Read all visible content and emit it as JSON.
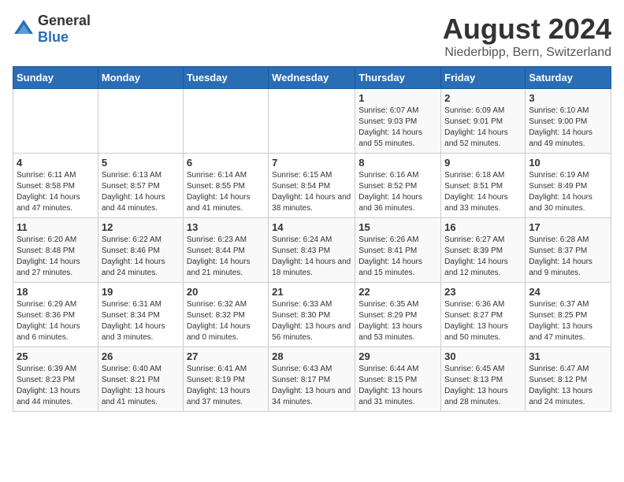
{
  "logo": {
    "general": "General",
    "blue": "Blue"
  },
  "title": "August 2024",
  "subtitle": "Niederbipp, Bern, Switzerland",
  "days_of_week": [
    "Sunday",
    "Monday",
    "Tuesday",
    "Wednesday",
    "Thursday",
    "Friday",
    "Saturday"
  ],
  "weeks": [
    [
      {
        "day": "",
        "details": ""
      },
      {
        "day": "",
        "details": ""
      },
      {
        "day": "",
        "details": ""
      },
      {
        "day": "",
        "details": ""
      },
      {
        "day": "1",
        "details": "Sunrise: 6:07 AM\nSunset: 9:03 PM\nDaylight: 14 hours and 55 minutes."
      },
      {
        "day": "2",
        "details": "Sunrise: 6:09 AM\nSunset: 9:01 PM\nDaylight: 14 hours and 52 minutes."
      },
      {
        "day": "3",
        "details": "Sunrise: 6:10 AM\nSunset: 9:00 PM\nDaylight: 14 hours and 49 minutes."
      }
    ],
    [
      {
        "day": "4",
        "details": "Sunrise: 6:11 AM\nSunset: 8:58 PM\nDaylight: 14 hours and 47 minutes."
      },
      {
        "day": "5",
        "details": "Sunrise: 6:13 AM\nSunset: 8:57 PM\nDaylight: 14 hours and 44 minutes."
      },
      {
        "day": "6",
        "details": "Sunrise: 6:14 AM\nSunset: 8:55 PM\nDaylight: 14 hours and 41 minutes."
      },
      {
        "day": "7",
        "details": "Sunrise: 6:15 AM\nSunset: 8:54 PM\nDaylight: 14 hours and 38 minutes."
      },
      {
        "day": "8",
        "details": "Sunrise: 6:16 AM\nSunset: 8:52 PM\nDaylight: 14 hours and 36 minutes."
      },
      {
        "day": "9",
        "details": "Sunrise: 6:18 AM\nSunset: 8:51 PM\nDaylight: 14 hours and 33 minutes."
      },
      {
        "day": "10",
        "details": "Sunrise: 6:19 AM\nSunset: 8:49 PM\nDaylight: 14 hours and 30 minutes."
      }
    ],
    [
      {
        "day": "11",
        "details": "Sunrise: 6:20 AM\nSunset: 8:48 PM\nDaylight: 14 hours and 27 minutes."
      },
      {
        "day": "12",
        "details": "Sunrise: 6:22 AM\nSunset: 8:46 PM\nDaylight: 14 hours and 24 minutes."
      },
      {
        "day": "13",
        "details": "Sunrise: 6:23 AM\nSunset: 8:44 PM\nDaylight: 14 hours and 21 minutes."
      },
      {
        "day": "14",
        "details": "Sunrise: 6:24 AM\nSunset: 8:43 PM\nDaylight: 14 hours and 18 minutes."
      },
      {
        "day": "15",
        "details": "Sunrise: 6:26 AM\nSunset: 8:41 PM\nDaylight: 14 hours and 15 minutes."
      },
      {
        "day": "16",
        "details": "Sunrise: 6:27 AM\nSunset: 8:39 PM\nDaylight: 14 hours and 12 minutes."
      },
      {
        "day": "17",
        "details": "Sunrise: 6:28 AM\nSunset: 8:37 PM\nDaylight: 14 hours and 9 minutes."
      }
    ],
    [
      {
        "day": "18",
        "details": "Sunrise: 6:29 AM\nSunset: 8:36 PM\nDaylight: 14 hours and 6 minutes."
      },
      {
        "day": "19",
        "details": "Sunrise: 6:31 AM\nSunset: 8:34 PM\nDaylight: 14 hours and 3 minutes."
      },
      {
        "day": "20",
        "details": "Sunrise: 6:32 AM\nSunset: 8:32 PM\nDaylight: 14 hours and 0 minutes."
      },
      {
        "day": "21",
        "details": "Sunrise: 6:33 AM\nSunset: 8:30 PM\nDaylight: 13 hours and 56 minutes."
      },
      {
        "day": "22",
        "details": "Sunrise: 6:35 AM\nSunset: 8:29 PM\nDaylight: 13 hours and 53 minutes."
      },
      {
        "day": "23",
        "details": "Sunrise: 6:36 AM\nSunset: 8:27 PM\nDaylight: 13 hours and 50 minutes."
      },
      {
        "day": "24",
        "details": "Sunrise: 6:37 AM\nSunset: 8:25 PM\nDaylight: 13 hours and 47 minutes."
      }
    ],
    [
      {
        "day": "25",
        "details": "Sunrise: 6:39 AM\nSunset: 8:23 PM\nDaylight: 13 hours and 44 minutes."
      },
      {
        "day": "26",
        "details": "Sunrise: 6:40 AM\nSunset: 8:21 PM\nDaylight: 13 hours and 41 minutes."
      },
      {
        "day": "27",
        "details": "Sunrise: 6:41 AM\nSunset: 8:19 PM\nDaylight: 13 hours and 37 minutes."
      },
      {
        "day": "28",
        "details": "Sunrise: 6:43 AM\nSunset: 8:17 PM\nDaylight: 13 hours and 34 minutes."
      },
      {
        "day": "29",
        "details": "Sunrise: 6:44 AM\nSunset: 8:15 PM\nDaylight: 13 hours and 31 minutes."
      },
      {
        "day": "30",
        "details": "Sunrise: 6:45 AM\nSunset: 8:13 PM\nDaylight: 13 hours and 28 minutes."
      },
      {
        "day": "31",
        "details": "Sunrise: 6:47 AM\nSunset: 8:12 PM\nDaylight: 13 hours and 24 minutes."
      }
    ]
  ]
}
